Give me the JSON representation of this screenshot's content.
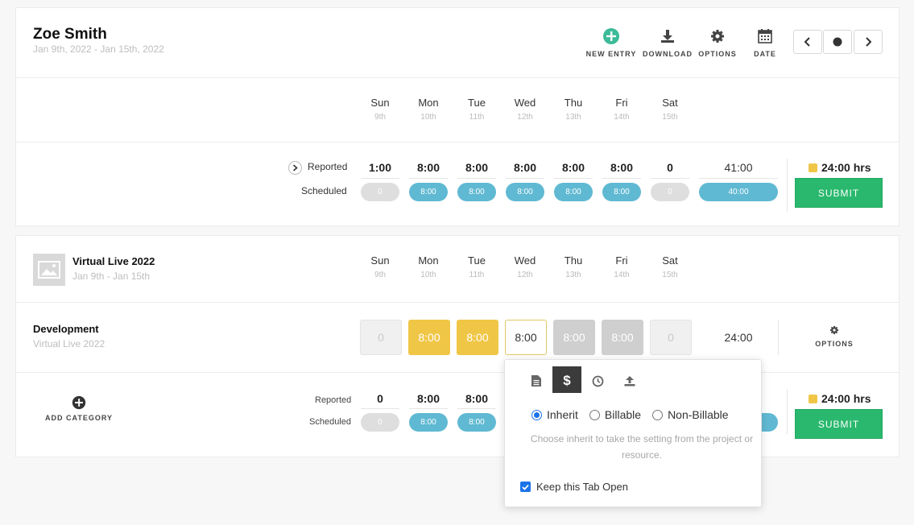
{
  "header": {
    "user_name": "Zoe Smith",
    "date_range": "Jan 9th, 2022 - Jan 15th, 2022",
    "toolbar": {
      "new_entry": "NEW ENTRY",
      "download": "DOWNLOAD",
      "options": "OPTIONS",
      "date": "DATE"
    }
  },
  "days": [
    {
      "name": "Sun",
      "num": "9th"
    },
    {
      "name": "Mon",
      "num": "10th"
    },
    {
      "name": "Tue",
      "num": "11th"
    },
    {
      "name": "Wed",
      "num": "12th"
    },
    {
      "name": "Thu",
      "num": "13th"
    },
    {
      "name": "Fri",
      "num": "14th"
    },
    {
      "name": "Sat",
      "num": "15th"
    }
  ],
  "summary": {
    "reported_label": "Reported",
    "scheduled_label": "Scheduled",
    "reported": [
      "1:00",
      "8:00",
      "8:00",
      "8:00",
      "8:00",
      "8:00",
      "0"
    ],
    "reported_total": "41:00",
    "scheduled": [
      "0",
      "8:00",
      "8:00",
      "8:00",
      "8:00",
      "8:00",
      "0"
    ],
    "scheduled_total": "40:00",
    "hrs": "24:00 hrs",
    "submit": "SUBMIT"
  },
  "project": {
    "name": "Virtual Live 2022",
    "dates": "Jan 9th - Jan 15th",
    "category": {
      "name": "Development",
      "project": "Virtual Live 2022",
      "cells": [
        "0",
        "8:00",
        "8:00",
        "8:00",
        "8:00",
        "8:00",
        "0"
      ],
      "total": "24:00",
      "options": "OPTIONS"
    },
    "add_category": "ADD CATEGORY",
    "footer": {
      "reported_label": "Reported",
      "scheduled_label": "Scheduled",
      "reported": [
        "0",
        "8:00",
        "8:00"
      ],
      "scheduled": [
        "0",
        "8:00",
        "8:00"
      ],
      "hrs": "24:00 hrs",
      "submit": "SUBMIT"
    }
  },
  "popup": {
    "options": [
      "Inherit",
      "Billable",
      "Non-Billable"
    ],
    "selected": "Inherit",
    "help": "Choose inherit to take the setting from the project or resource.",
    "keep_open": "Keep this Tab Open",
    "keep_open_checked": true
  },
  "colors": {
    "accent_green": "#29b86d",
    "accent_teal": "#3dbb98",
    "pill_blue": "#60b9d2",
    "cell_yellow": "#f0c646"
  }
}
